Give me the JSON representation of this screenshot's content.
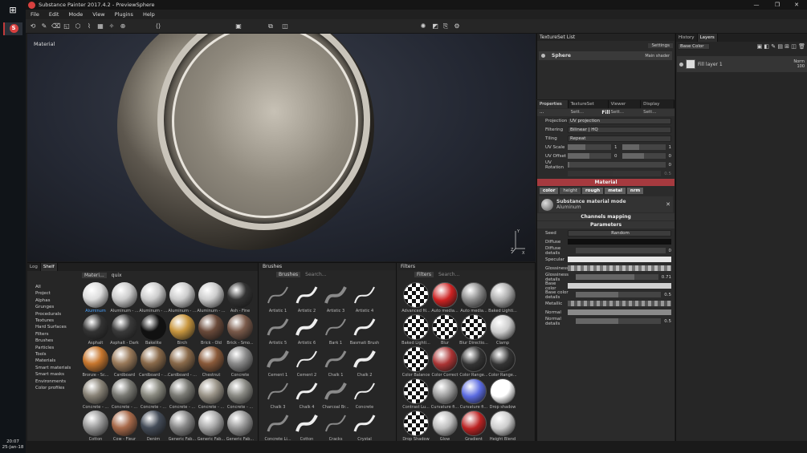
{
  "app": {
    "title": "Substance Painter 2017.4.2 - PreviewSphere",
    "clock": {
      "time": "20:07",
      "date": "25-Jan-18"
    }
  },
  "menu": [
    "File",
    "Edit",
    "Mode",
    "View",
    "Plugins",
    "Help"
  ],
  "viewport": {
    "label": "Material"
  },
  "textureset": {
    "title": "TextureSet List",
    "settings_label": "Settings",
    "item": "Sphere",
    "shader": "Main shader"
  },
  "properties": {
    "tabs": [
      "Properties ...",
      "TextureSet Sett...",
      "Viewer Sett...",
      "Display Sett..."
    ],
    "fill": {
      "title": "Fill",
      "projection_label": "Projection",
      "projection_value": "UV projection",
      "filtering_label": "Filtering",
      "filtering_value": "Bilinear | HQ",
      "tiling_label": "Tiling",
      "tiling_value": "Repeat",
      "uvscale_label": "UV Scale",
      "uvscale_v1": "1",
      "uvscale_v2": "1",
      "uvoffset_label": "UV Offset",
      "uvoffset_v1": "0",
      "uvoffset_v2": "0",
      "uvrot_label": "UV Rotation",
      "uvrot_v": "0",
      "disabled_v": "0.5"
    },
    "material": {
      "title": "Material",
      "channels": [
        "color",
        "height",
        "rough",
        "metal",
        "nrm"
      ],
      "mode_label": "Substance material mode",
      "mode_value": "Aluminum"
    },
    "channels_mapping": "Channels mapping",
    "parameters": {
      "title": "Parameters",
      "seed_label": "Seed",
      "seed_value": "Random",
      "diffuse_label": "Diffuse",
      "diffuse_details_label": "Diffuse details",
      "diffuse_details_v": "0",
      "specular_label": "Specular",
      "glossiness_label": "Glossiness",
      "glossiness_details_label": "Glossiness details",
      "glossiness_details_v": "0.71",
      "basecolor_label": "Base color",
      "basecolor_details_label": "Base color details",
      "basecolor_details_v": "0.5",
      "metallic_label": "Metallic",
      "normal_label": "Normal",
      "normal_details_label": "Normal details",
      "normal_details_v": "0.5"
    }
  },
  "layers": {
    "tabs": [
      "History",
      "Layers"
    ],
    "channel": "Base Color",
    "item": "Fill layer 1",
    "blend": "Norm",
    "opacity": "100"
  },
  "shelf": {
    "tabs": [
      "Log",
      "Shelf"
    ],
    "filter_tag": "Materi...",
    "search": "quix",
    "categories": [
      "All",
      "Project",
      "Alphas",
      "Grunges",
      "Procedurals",
      "Textures",
      "Hard Surfaces",
      "Filters",
      "Brushes",
      "Particles",
      "Tools",
      "Materials",
      "Smart materials",
      "Smart masks",
      "Environments",
      "Color profiles"
    ],
    "items": [
      "Aluminum",
      "Aluminum - ...",
      "Aluminum - ...",
      "Aluminum - ...",
      "Aluminum - ...",
      "Ash - Fine",
      "Asphalt",
      "Asphalt - Dark",
      "Bakelite",
      "Birch",
      "Brick - Old",
      "Brick - Smo...",
      "Bronze - Sc...",
      "Cardboard",
      "Cardboard - ...",
      "Cardboard - ...",
      "Chestnut",
      "Concrete",
      "Concrete - ...",
      "Concrete - ...",
      "Concrete - ...",
      "Concrete - ...",
      "Concrete - ...",
      "Concrete - ...",
      "Cotton",
      "Cow - Fleur",
      "Denim",
      "Generic Fab...",
      "Generic Fab...",
      "Generic Fab..."
    ]
  },
  "brushes": {
    "title": "Brushes",
    "tag": "Brushes",
    "search": "Search...",
    "items": [
      "Artistic 1",
      "Artistic 2",
      "Artistic 3",
      "Artistic 4",
      "Artistic 5",
      "Artistic 6",
      "Bark 1",
      "Basmati Brush",
      "Cement 1",
      "Cement 2",
      "Chalk 1",
      "Chalk 2",
      "Chalk 3",
      "Chalk 4",
      "Charcoal Br...",
      "Concrete",
      "Concrete Li...",
      "Cotton",
      "Cracks",
      "Crystal"
    ]
  },
  "filters": {
    "title": "Filters",
    "tag": "Filters",
    "search": "Search...",
    "items": [
      "Advanced fil...",
      "Auto media...",
      "Auto media...",
      "Baked Lighti...",
      "Baked Lighti...",
      "Blur",
      "Blur Directio...",
      "Clamp",
      "Color Balance",
      "Color Correct",
      "Color Range...",
      "Color Range...",
      "Contrast Lu...",
      "Curvature fi...",
      "Curvature fi...",
      "Drop shadow",
      "Drop Shadow",
      "Glow",
      "Gradient",
      "Height Blend"
    ]
  },
  "colors": {
    "accent_red": "#a63a3f",
    "logo_red": "#d8403f"
  }
}
